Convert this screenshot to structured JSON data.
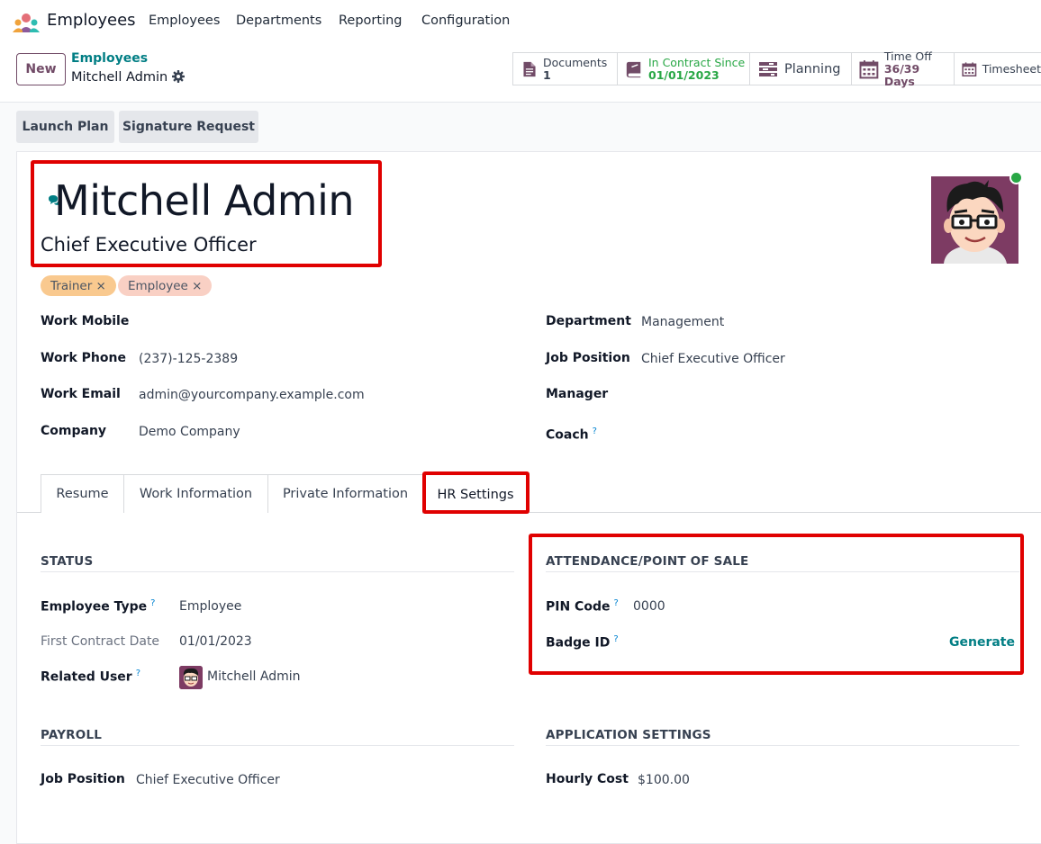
{
  "navbar": {
    "app_name": "Employees",
    "menu": [
      "Employees",
      "Departments",
      "Reporting",
      "Configuration"
    ]
  },
  "control_panel": {
    "new_label": "New",
    "breadcrumb_parent": "Employees",
    "breadcrumb_current": "Mitchell Admin",
    "smart_buttons": [
      {
        "title": "Documents",
        "value": "1",
        "icon": "file-icon"
      },
      {
        "title": "In Contract Since",
        "value": "01/01/2023",
        "icon": "book-icon"
      },
      {
        "title": "Planning",
        "value": "",
        "icon": "tasks-icon"
      },
      {
        "title": "Time Off",
        "value": "36/39 Days",
        "icon": "calendar-icon"
      },
      {
        "title": "Timesheet",
        "value": "",
        "icon": "calendar-icon"
      }
    ]
  },
  "actions": {
    "launch_plan": "Launch Plan",
    "signature_request": "Signature Request"
  },
  "employee": {
    "name": "Mitchell Admin",
    "job_title": "Chief Executive Officer",
    "tags": [
      {
        "label": "Trainer ×",
        "color": "#f9c98f"
      },
      {
        "label": "Employee ×",
        "color": "#f9d0c4"
      }
    ],
    "left_fields": [
      {
        "label": "Work Mobile",
        "value": ""
      },
      {
        "label": "Work Phone",
        "value": "(237)-125-2389"
      },
      {
        "label": "Work Email",
        "value": "admin@yourcompany.example.com"
      },
      {
        "label": "Company",
        "value": "Demo Company"
      }
    ],
    "right_fields": [
      {
        "label": "Department",
        "value": "Management"
      },
      {
        "label": "Job Position",
        "value": "Chief Executive Officer"
      },
      {
        "label": "Manager",
        "value": ""
      },
      {
        "label": "Coach",
        "value": ""
      }
    ]
  },
  "tabs": [
    "Resume",
    "Work Information",
    "Private Information",
    "HR Settings"
  ],
  "hr_settings": {
    "status": {
      "title": "STATUS",
      "employee_type_label": "Employee Type",
      "employee_type": "Employee",
      "first_contract_label": "First Contract Date",
      "first_contract": "01/01/2023",
      "related_user_label": "Related User",
      "related_user": "Mitchell Admin"
    },
    "attendance": {
      "title": "ATTENDANCE/POINT OF SALE",
      "pin_label": "PIN Code",
      "pin": "0000",
      "badge_label": "Badge ID",
      "generate": "Generate"
    },
    "payroll": {
      "title": "PAYROLL",
      "job_position_label": "Job Position",
      "job_position": "Chief Executive Officer"
    },
    "application": {
      "title": "APPLICATION SETTINGS",
      "hourly_cost_label": "Hourly Cost",
      "hourly_cost": "$100.00"
    }
  },
  "help_mark": "?",
  "colors": {
    "brand": "#714b67",
    "link": "#017e84",
    "highlight": "#e00000",
    "online": "#28a745"
  }
}
